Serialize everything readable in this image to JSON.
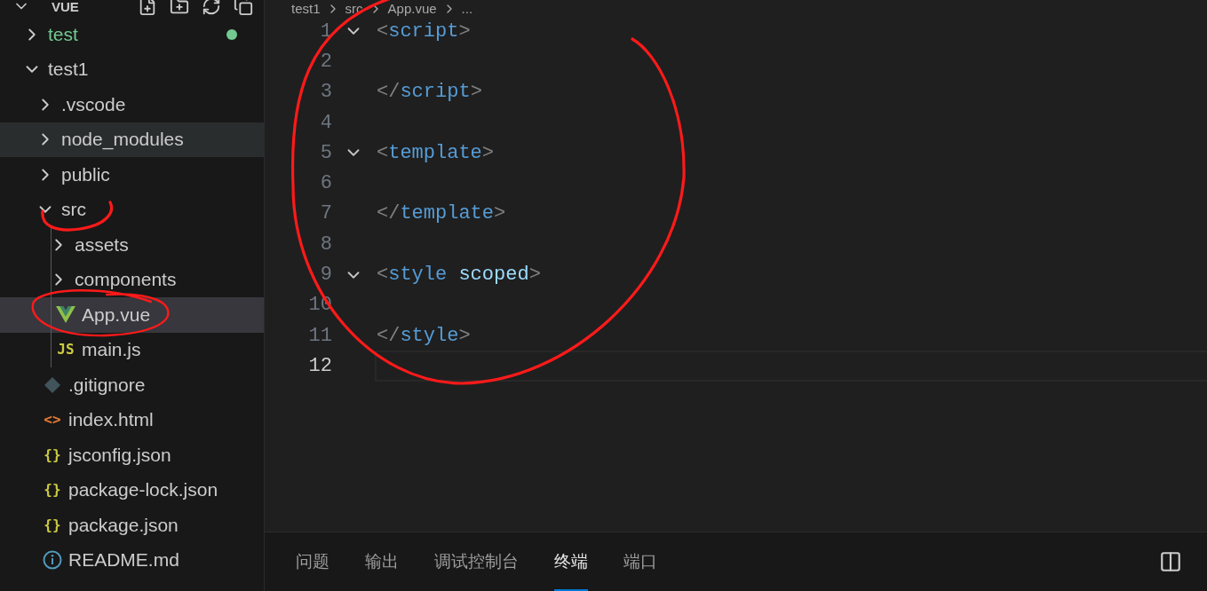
{
  "sidebar": {
    "title": "VUE",
    "tree": [
      {
        "name": "test",
        "kind": "folder",
        "expanded": false,
        "selected": false,
        "color": "#73c991"
      },
      {
        "name": "test1",
        "kind": "folder",
        "expanded": true,
        "selected": false,
        "children": [
          {
            "name": ".vscode",
            "kind": "folder",
            "expanded": false,
            "selected": false
          },
          {
            "name": "node_modules",
            "kind": "folder",
            "expanded": false,
            "selected": false,
            "hovered": true
          },
          {
            "name": "public",
            "kind": "folder",
            "expanded": false,
            "selected": false
          },
          {
            "name": "src",
            "kind": "folder",
            "expanded": true,
            "selected": false,
            "children": [
              {
                "name": "assets",
                "kind": "folder",
                "expanded": false,
                "selected": false
              },
              {
                "name": "components",
                "kind": "folder",
                "expanded": false,
                "selected": false
              },
              {
                "name": "App.vue",
                "kind": "vue-file",
                "selected": true
              },
              {
                "name": "main.js",
                "kind": "js-file",
                "icon_text": "JS",
                "selected": false
              }
            ]
          },
          {
            "name": ".gitignore",
            "kind": "git-file",
            "selected": false
          },
          {
            "name": "index.html",
            "kind": "html-file",
            "icon_text": "<>",
            "selected": false
          },
          {
            "name": "jsconfig.json",
            "kind": "json-file",
            "icon_text": "{}",
            "selected": false
          },
          {
            "name": "package-lock.json",
            "kind": "json-file",
            "icon_text": "{}",
            "selected": false
          },
          {
            "name": "package.json",
            "kind": "json-file",
            "icon_text": "{}",
            "selected": false
          },
          {
            "name": "README.md",
            "kind": "info-file",
            "selected": false
          }
        ]
      }
    ]
  },
  "breadcrumb": [
    "test1",
    "src",
    "App.vue",
    "..."
  ],
  "editor": {
    "lines": [
      {
        "number": "1",
        "fold": true,
        "current": false,
        "tokens": [
          {
            "kind": "punct",
            "text": "<"
          },
          {
            "kind": "tag",
            "text": "script"
          },
          {
            "kind": "punct",
            "text": ">"
          }
        ]
      },
      {
        "number": "2",
        "fold": false,
        "current": false
      },
      {
        "number": "3",
        "fold": false,
        "current": false,
        "tokens": [
          {
            "kind": "punct",
            "text": "</"
          },
          {
            "kind": "tag",
            "text": "script"
          },
          {
            "kind": "punct",
            "text": ">"
          }
        ]
      },
      {
        "number": "4",
        "fold": false,
        "current": false
      },
      {
        "number": "5",
        "fold": true,
        "current": false,
        "tokens": [
          {
            "kind": "punct",
            "text": "<"
          },
          {
            "kind": "tag",
            "text": "template"
          },
          {
            "kind": "punct",
            "text": ">"
          }
        ]
      },
      {
        "number": "6",
        "fold": false,
        "current": false
      },
      {
        "number": "7",
        "fold": false,
        "current": false,
        "tokens": [
          {
            "kind": "punct",
            "text": "</"
          },
          {
            "kind": "tag",
            "text": "template"
          },
          {
            "kind": "punct",
            "text": ">"
          }
        ]
      },
      {
        "number": "8",
        "fold": false,
        "current": false
      },
      {
        "number": "9",
        "fold": true,
        "current": false,
        "tokens": [
          {
            "kind": "punct",
            "text": "<"
          },
          {
            "kind": "tag",
            "text": "style"
          },
          {
            "kind": "attr",
            "text": "scoped"
          },
          {
            "kind": "punct",
            "text": ">"
          }
        ]
      },
      {
        "number": "10",
        "fold": false,
        "current": false
      },
      {
        "number": "11",
        "fold": false,
        "current": false,
        "tokens": [
          {
            "kind": "punct",
            "text": "</"
          },
          {
            "kind": "tag",
            "text": "style"
          },
          {
            "kind": "punct",
            "text": ">"
          }
        ]
      },
      {
        "number": "12",
        "fold": false,
        "current": true
      }
    ]
  },
  "panel": {
    "tabs": [
      {
        "label": "问题",
        "selected": false
      },
      {
        "label": "输出",
        "selected": false
      },
      {
        "label": "调试控制台",
        "selected": false
      },
      {
        "label": "终端",
        "selected": true
      },
      {
        "label": "端口",
        "selected": false
      }
    ]
  },
  "annotations": [
    {
      "kind": "loop",
      "color": "#ff1a1a"
    },
    {
      "kind": "underline",
      "color": "#ff1a1a"
    },
    {
      "kind": "loop",
      "color": "#ff1a1a"
    }
  ]
}
